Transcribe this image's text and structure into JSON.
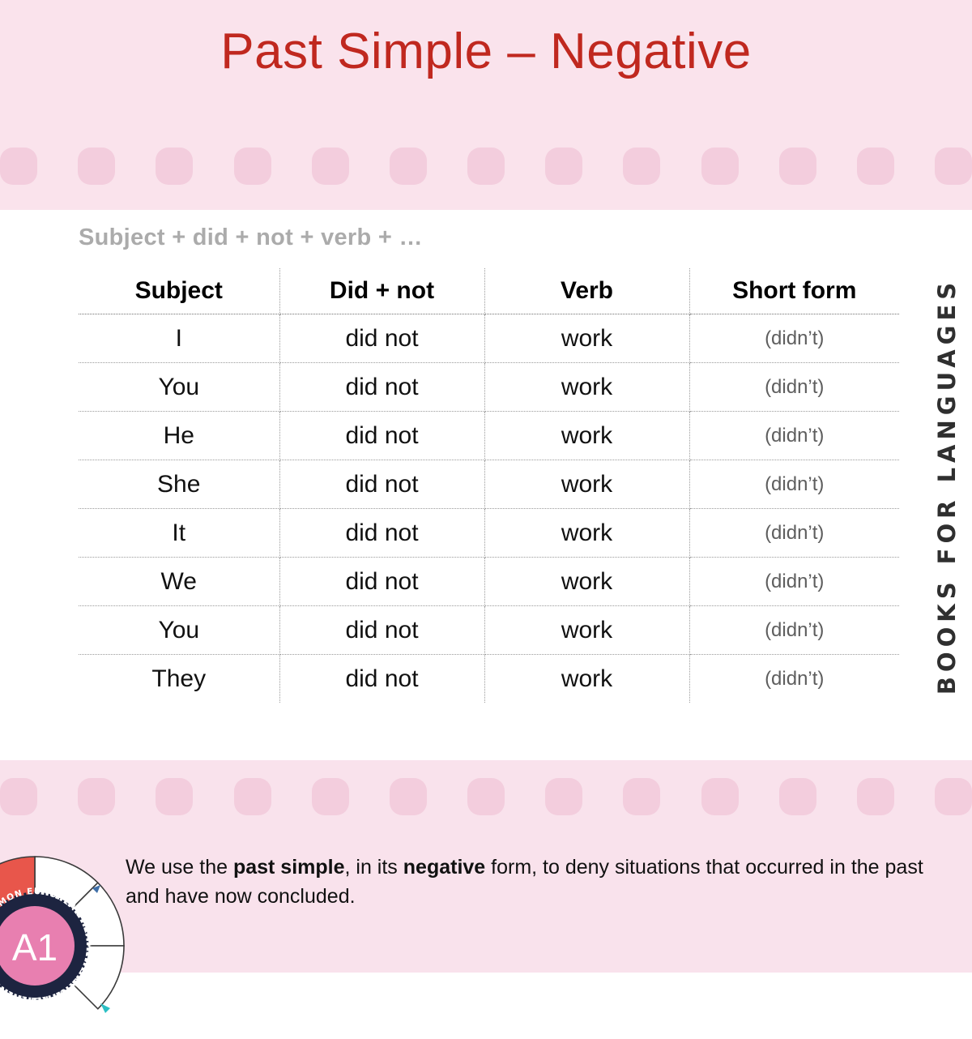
{
  "header": {
    "title": "Past Simple – Negative",
    "title_color": "#C0281F",
    "band_color": "#FAE3EC",
    "dot_color": "#F3CDDD"
  },
  "formula": "Subject + did + not + verb + …",
  "table": {
    "columns": [
      "Subject",
      "Did + not",
      "Verb",
      "Short form"
    ],
    "rows": [
      {
        "subject": "I",
        "didnot": "did not",
        "verb": "work",
        "short": "(didn’t)"
      },
      {
        "subject": "You",
        "didnot": "did not",
        "verb": "work",
        "short": "(didn’t)"
      },
      {
        "subject": "He",
        "didnot": "did not",
        "verb": "work",
        "short": "(didn’t)"
      },
      {
        "subject": "She",
        "didnot": "did not",
        "verb": "work",
        "short": "(didn’t)"
      },
      {
        "subject": "It",
        "didnot": "did not",
        "verb": "work",
        "short": "(didn’t)"
      },
      {
        "subject": "We",
        "didnot": "did not",
        "verb": "work",
        "short": "(didn’t)"
      },
      {
        "subject": "You",
        "didnot": "did not",
        "verb": "work",
        "short": "(didn’t)"
      },
      {
        "subject": "They",
        "didnot": "did not",
        "verb": "work",
        "short": "(didn’t)"
      }
    ]
  },
  "brand": {
    "vertical_text": "BOOKS FOR LANGUAGES"
  },
  "note": {
    "part1": "We use the ",
    "bold1": "past simple",
    "part2": ", in its ",
    "bold2": "negative",
    "part3": " form, to deny situations that occurred in the past and have now concluded."
  },
  "badge": {
    "level": "A1",
    "ring_text": "COMMON EUROPEAN FRAMEWORK OF REFERENCE",
    "seal_color": "#E87FB0",
    "ring_color": "#1d2440"
  },
  "dots": {
    "count": 13
  }
}
